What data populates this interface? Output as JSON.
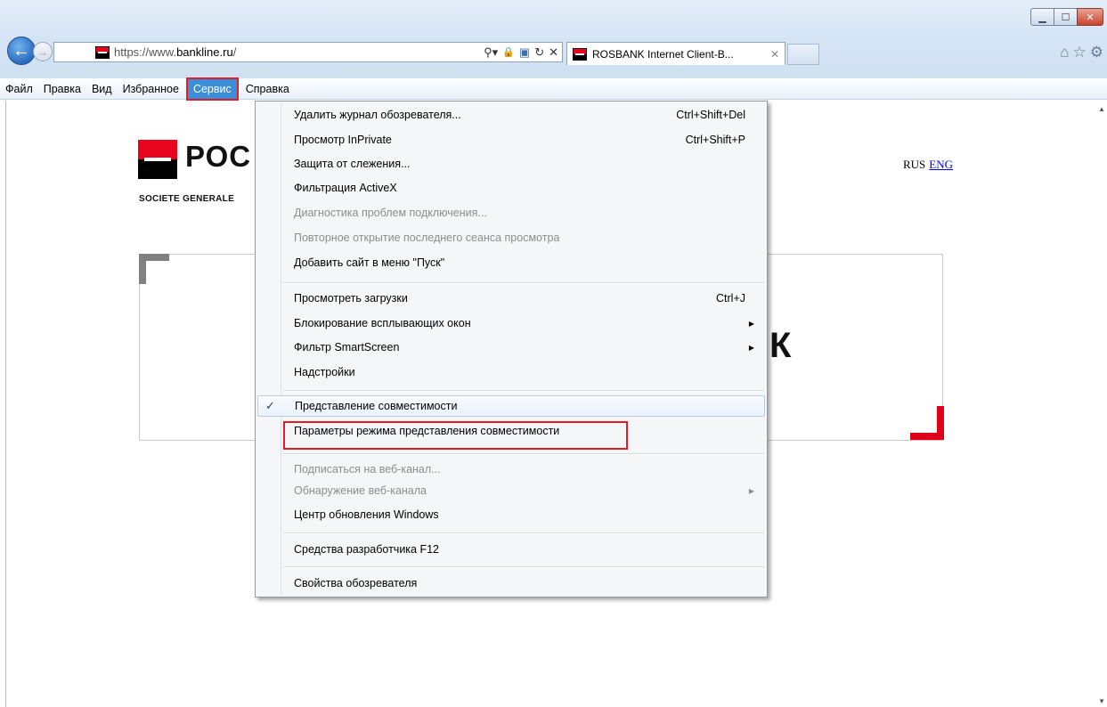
{
  "window": {
    "controls": {
      "minimize": "▁",
      "maximize": "☐",
      "close": "✕"
    }
  },
  "address_bar": {
    "url_prefix": "https://www.",
    "url_domain": "bankline.ru",
    "url_suffix": "/",
    "tools": {
      "search": "⚲▾",
      "lock": "🔒",
      "compat": "▣",
      "refresh": "↻",
      "stop": "✕"
    }
  },
  "tab": {
    "title": "ROSBANK Internet Client-B...",
    "close": "✕"
  },
  "chrome_icons": {
    "home": "⌂",
    "favorites": "☆",
    "tools": "⚙"
  },
  "menubar": {
    "items": [
      "Файл",
      "Правка",
      "Вид",
      "Избранное",
      "Сервис",
      "Справка"
    ],
    "active_index": 4
  },
  "page": {
    "logo_text": "РОС",
    "logo_subtitle": "SOCIETE GENERALE",
    "lang_rus": "RUS",
    "lang_eng": "ENG",
    "heading_fragment": "К"
  },
  "dropdown": {
    "items": [
      {
        "label": "Удалить журнал обозревателя...",
        "shortcut": "Ctrl+Shift+Del"
      },
      {
        "label": "Просмотр InPrivate",
        "shortcut": "Ctrl+Shift+P"
      },
      {
        "label": "Защита от слежения...",
        "shortcut": ""
      },
      {
        "label": "Фильтрация ActiveX",
        "shortcut": ""
      },
      {
        "label": "Диагностика проблем подключения...",
        "shortcut": "",
        "disabled": true
      },
      {
        "label": "Повторное открытие последнего сеанса просмотра",
        "shortcut": "",
        "disabled": true
      },
      {
        "label": "Добавить сайт в меню \"Пуск\"",
        "shortcut": ""
      },
      {
        "label": "Просмотреть загрузки",
        "shortcut": "Ctrl+J"
      },
      {
        "label": "Блокирование всплывающих окон",
        "shortcut": "",
        "submenu": true
      },
      {
        "label": "Фильтр SmartScreen",
        "shortcut": "",
        "submenu": true
      },
      {
        "label": "Надстройки",
        "shortcut": ""
      },
      {
        "label": "Представление совместимости",
        "shortcut": "",
        "checked": true
      },
      {
        "label": "Параметры режима представления совместимости",
        "shortcut": "",
        "highlighted": true
      },
      {
        "label": "Подписаться на веб-канал...",
        "shortcut": "",
        "disabled": true
      },
      {
        "label": "Обнаружение веб-канала",
        "shortcut": "",
        "disabled": true,
        "submenu": true
      },
      {
        "label": "Центр обновления Windows",
        "shortcut": ""
      },
      {
        "label": "Средства разработчика F12",
        "shortcut": ""
      },
      {
        "label": "Свойства обозревателя",
        "shortcut": ""
      }
    ],
    "check_mark": "✓",
    "submenu_arrow": "▶"
  },
  "colors": {
    "annotation_red": "#e01e2b",
    "menu_active_blue": "#3b8ed8",
    "brand_red": "#e9041e",
    "link_blue": "#0000ee"
  }
}
